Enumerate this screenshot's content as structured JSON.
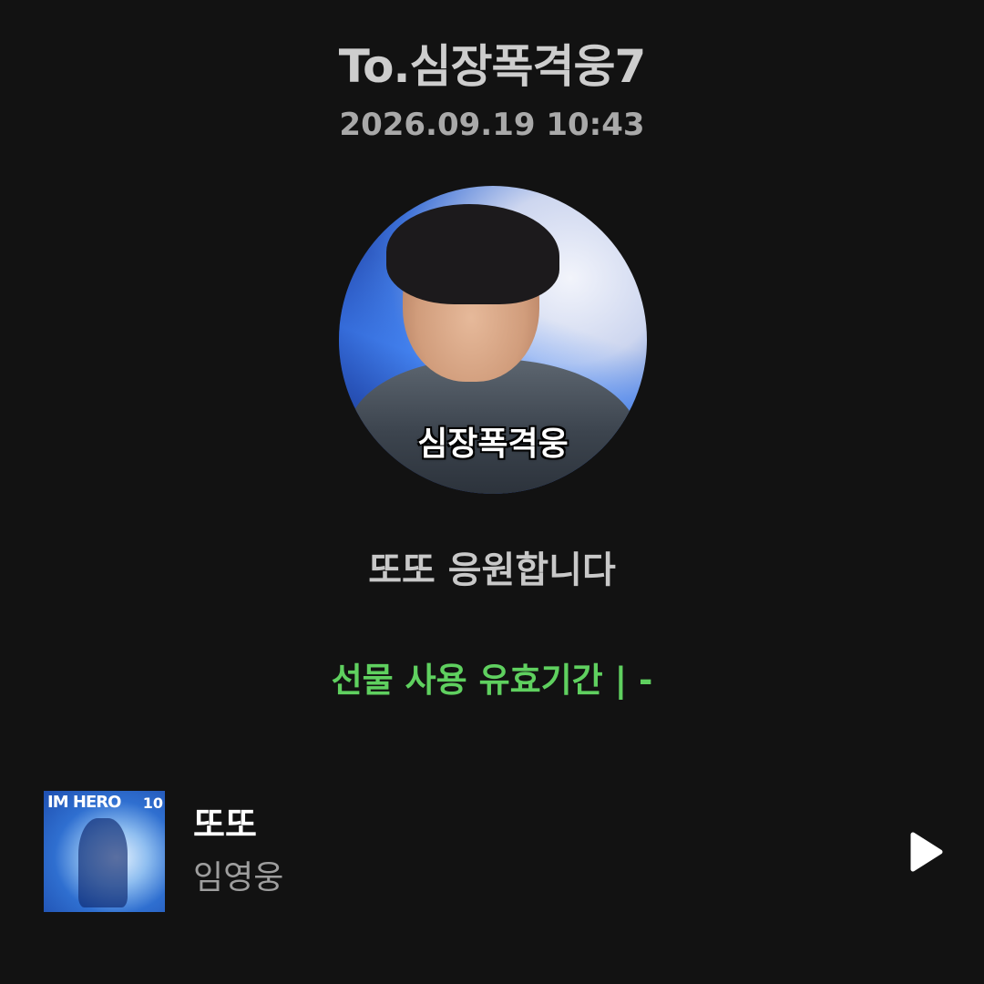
{
  "header": {
    "recipient": "To.심장폭격웅7",
    "timestamp": "2026.09.19 10:43"
  },
  "avatar": {
    "caption": "심장폭격웅"
  },
  "message": "또또 응원합니다",
  "validity": "선물 사용 유효기간 |   -",
  "track": {
    "title": "또또",
    "artist": "임영웅",
    "album_art": {
      "logo": "IM HERO",
      "number": "10"
    },
    "play_icon": "play-icon"
  },
  "colors": {
    "background": "#121212",
    "accent_green": "#5fd05f",
    "text_primary": "#ffffff",
    "text_secondary": "#9e9e9e"
  }
}
